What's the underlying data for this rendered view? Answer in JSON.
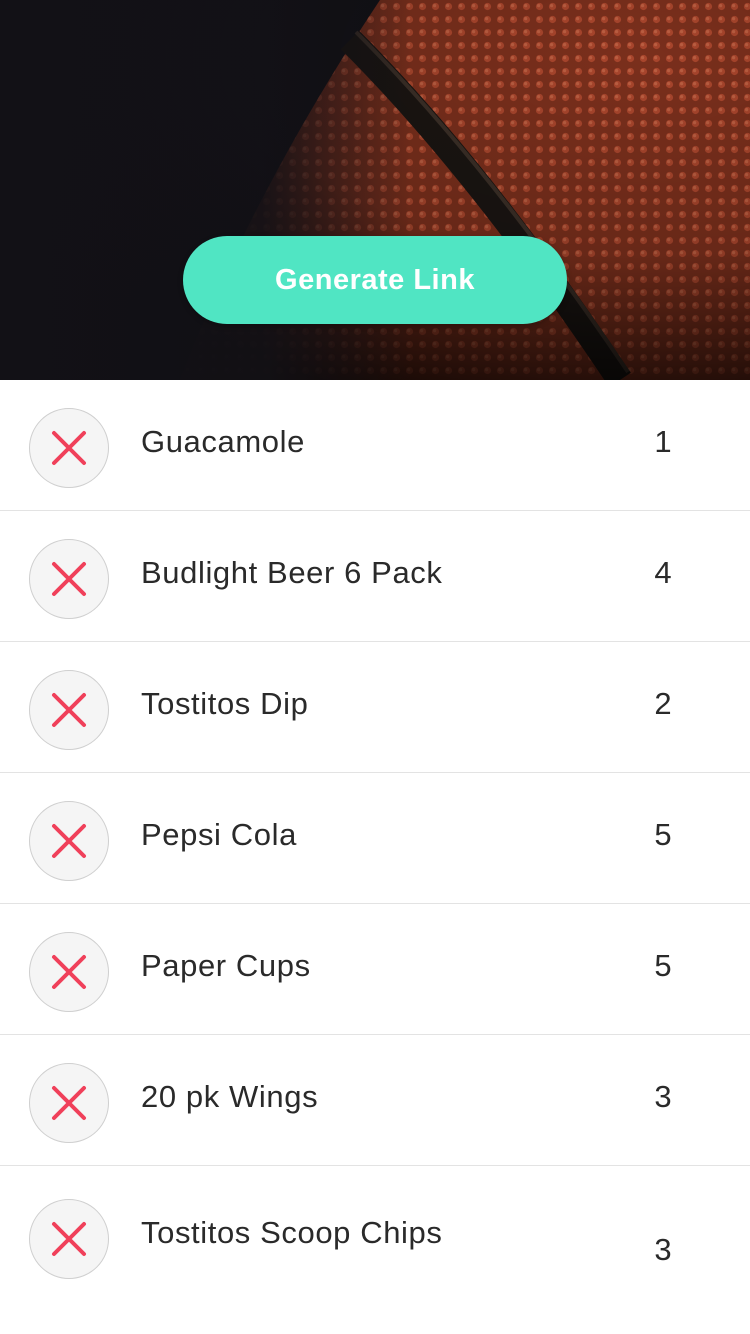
{
  "hero": {
    "image": "basketball-closeup",
    "button_label": "Generate Link"
  },
  "colors": {
    "button": "#50e5c3",
    "remove_x": "#f0405a",
    "text": "#2a2a2a"
  },
  "items": [
    {
      "name": "Guacamole",
      "qty": "1"
    },
    {
      "name": "Budlight Beer 6 Pack",
      "qty": "4"
    },
    {
      "name": "Tostitos Dip",
      "qty": "2"
    },
    {
      "name": "Pepsi Cola",
      "qty": "5"
    },
    {
      "name": "Paper Cups",
      "qty": "5"
    },
    {
      "name": "20 pk Wings",
      "qty": "3"
    },
    {
      "name": "Tostitos Scoop Chips",
      "qty": "3"
    }
  ]
}
